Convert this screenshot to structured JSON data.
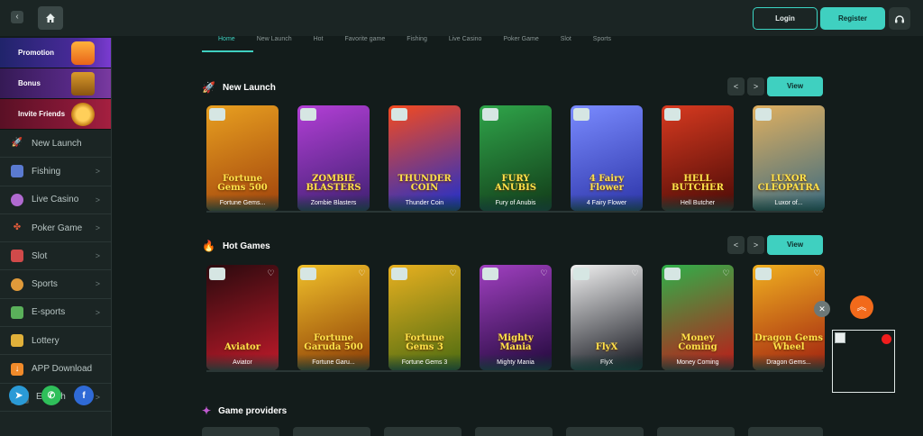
{
  "header": {
    "login_label": "Login",
    "register_label": "Register"
  },
  "sidebar": {
    "promos": [
      {
        "label": "Promotion",
        "icon": "gift-icon"
      },
      {
        "label": "Bonus",
        "icon": "treasure-chest-icon"
      },
      {
        "label": "Invite Friends",
        "icon": "medal-icon"
      }
    ],
    "items": [
      {
        "label": "New Launch",
        "icon": "rocket-icon",
        "chevron": false
      },
      {
        "label": "Fishing",
        "icon": "fish-icon",
        "chevron": true
      },
      {
        "label": "Live Casino",
        "icon": "casino-chip-icon",
        "chevron": true
      },
      {
        "label": "Poker Game",
        "icon": "cards-icon",
        "chevron": true
      },
      {
        "label": "Slot",
        "icon": "slot-machine-icon",
        "chevron": true
      },
      {
        "label": "Sports",
        "icon": "sports-icon",
        "chevron": true
      },
      {
        "label": "E-sports",
        "icon": "esports-icon",
        "chevron": true
      },
      {
        "label": "Lottery",
        "icon": "lottery-icon",
        "chevron": false
      },
      {
        "label": "APP Download",
        "icon": "download-icon",
        "chevron": false
      }
    ],
    "language": {
      "code": "EN",
      "label": "English"
    }
  },
  "tabs": [
    "Home",
    "New Launch",
    "Hot",
    "Favorite game",
    "Fishing",
    "Live Casino",
    "Poker Game",
    "Slot",
    "Sports"
  ],
  "new_launch": {
    "title": "New Launch",
    "view_label": "View",
    "games": [
      {
        "name": "Fortune Gems...",
        "art_text": "Fortune Gems 500",
        "colors": [
          "#e8a020",
          "#a0420c"
        ]
      },
      {
        "name": "Zombie Blasters",
        "art_text": "ZOMBIE BLASTERS",
        "colors": [
          "#b33fd6",
          "#3d2070"
        ]
      },
      {
        "name": "Thunder Coin",
        "art_text": "THUNDER COIN",
        "colors": [
          "#f54a1e",
          "#1a2fd0"
        ]
      },
      {
        "name": "Fury of Anubis",
        "art_text": "FURY ANUBIS",
        "colors": [
          "#2fa54a",
          "#123a18"
        ]
      },
      {
        "name": "4 Fairy Flower",
        "art_text": "4 Fairy Flower",
        "colors": [
          "#7a8bff",
          "#2c34a8"
        ]
      },
      {
        "name": "Hell Butcher",
        "art_text": "HELL BUTCHER",
        "colors": [
          "#d83a20",
          "#4a0a06"
        ]
      },
      {
        "name": "Luxor of...",
        "art_text": "LUXOR CLEOPATRA",
        "colors": [
          "#e0b060",
          "#3a6a80"
        ]
      }
    ]
  },
  "hot_games": {
    "title": "Hot Games",
    "view_label": "View",
    "games": [
      {
        "name": "Aviator",
        "art_text": "Aviator",
        "colors": [
          "#2a0a0e",
          "#c01a2a"
        ]
      },
      {
        "name": "Fortune Garu...",
        "art_text": "Fortune Garuda 500",
        "colors": [
          "#f0c02a",
          "#8a3a06"
        ]
      },
      {
        "name": "Fortune Gems 3",
        "art_text": "Fortune Gems 3",
        "colors": [
          "#e8b020",
          "#4a6a10"
        ]
      },
      {
        "name": "Mighty Mania",
        "art_text": "Mighty Mania",
        "colors": [
          "#a040c0",
          "#20083a"
        ]
      },
      {
        "name": "FlyX",
        "art_text": "FlyX",
        "colors": [
          "#f0f0f0",
          "#10121a"
        ]
      },
      {
        "name": "Money Coming",
        "art_text": "Money Coming",
        "colors": [
          "#2fb04a",
          "#c01818"
        ]
      },
      {
        "name": "Dragon Gems...",
        "art_text": "Dragon Gems Wheel",
        "colors": [
          "#f0b020",
          "#a02010"
        ]
      }
    ]
  },
  "providers": {
    "title": "Game providers"
  }
}
